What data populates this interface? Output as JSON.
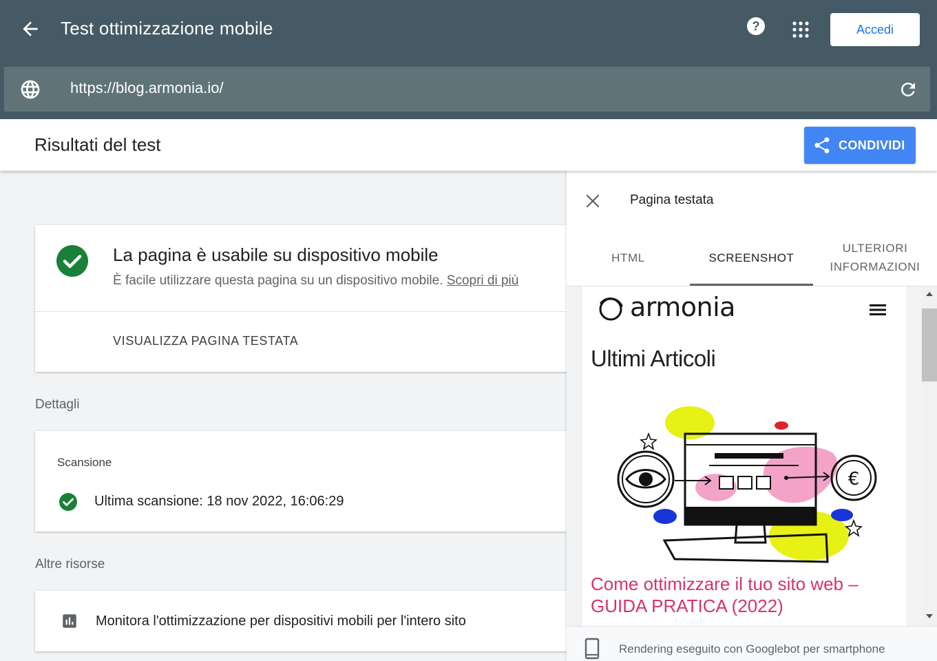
{
  "header": {
    "title": "Test ottimizzazione mobile",
    "signin_label": "Accedi",
    "back_icon": "arrow-back-icon",
    "help_icon": "help-circle-icon",
    "apps_icon": "apps-grid-icon"
  },
  "urlbar": {
    "url": "https://blog.armonia.io/",
    "globe_icon": "globe-icon",
    "reload_icon": "reload-icon"
  },
  "results": {
    "title": "Risultati del test",
    "share_label": "CONDIVIDI",
    "share_icon": "share-icon"
  },
  "summary": {
    "title": "La pagina è usabile su dispositivo mobile",
    "description": "È facile utilizzare questa pagina su un dispositivo mobile.",
    "learn_more": "Scopri di più",
    "view_tested": "VISUALIZZA PAGINA TESTATA",
    "status_color": "#188038"
  },
  "details": {
    "label": "Dettagli",
    "scan_title": "Scansione",
    "last_scan": "Ultima scansione: 18 nov 2022, 16:06:29"
  },
  "resources": {
    "label": "Altre risorse",
    "monitor_text": "Monitora l'ottimizzazione per dispositivi mobili per l'intero sito"
  },
  "panel": {
    "title": "Pagina testata",
    "tabs": [
      {
        "label": "HTML",
        "active": false
      },
      {
        "label": "SCREENSHOT",
        "active": true
      },
      {
        "label": "ULTERIORI INFORMAZIONI",
        "active": false
      }
    ],
    "footer": "Rendering eseguito con Googlebot per smartphone"
  },
  "screenshot": {
    "brand": "armonia",
    "heading": "Ultimi Articoli",
    "article_line1": "Come ottimizzare il tuo sito web –",
    "article_line2": "GUIDA PRATICA (2022)",
    "article_color": "#d6336c"
  },
  "colors": {
    "topbar": "#455a64",
    "urlbar": "#607378",
    "accent": "#4285f4",
    "success": "#188038"
  }
}
